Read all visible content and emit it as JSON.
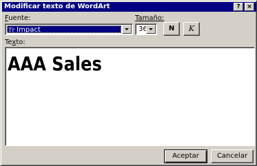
{
  "window": {
    "title": "Modificar texto de WordArt",
    "help_button": "?",
    "close_button": "×"
  },
  "font": {
    "label_underlined": "F",
    "label_rest": "uente:",
    "selected_prefix": "Tr",
    "selected": "Impact"
  },
  "size": {
    "label_rest": "Tamaño:",
    "value": "36"
  },
  "style_buttons": {
    "bold_label": "N",
    "italic_label": "K"
  },
  "text": {
    "label_pre": "Te",
    "label_underlined": "x",
    "label_post": "to:",
    "content": "AAA Sales"
  },
  "footer": {
    "ok_label": "Aceptar",
    "cancel_label": "Cancelar"
  }
}
